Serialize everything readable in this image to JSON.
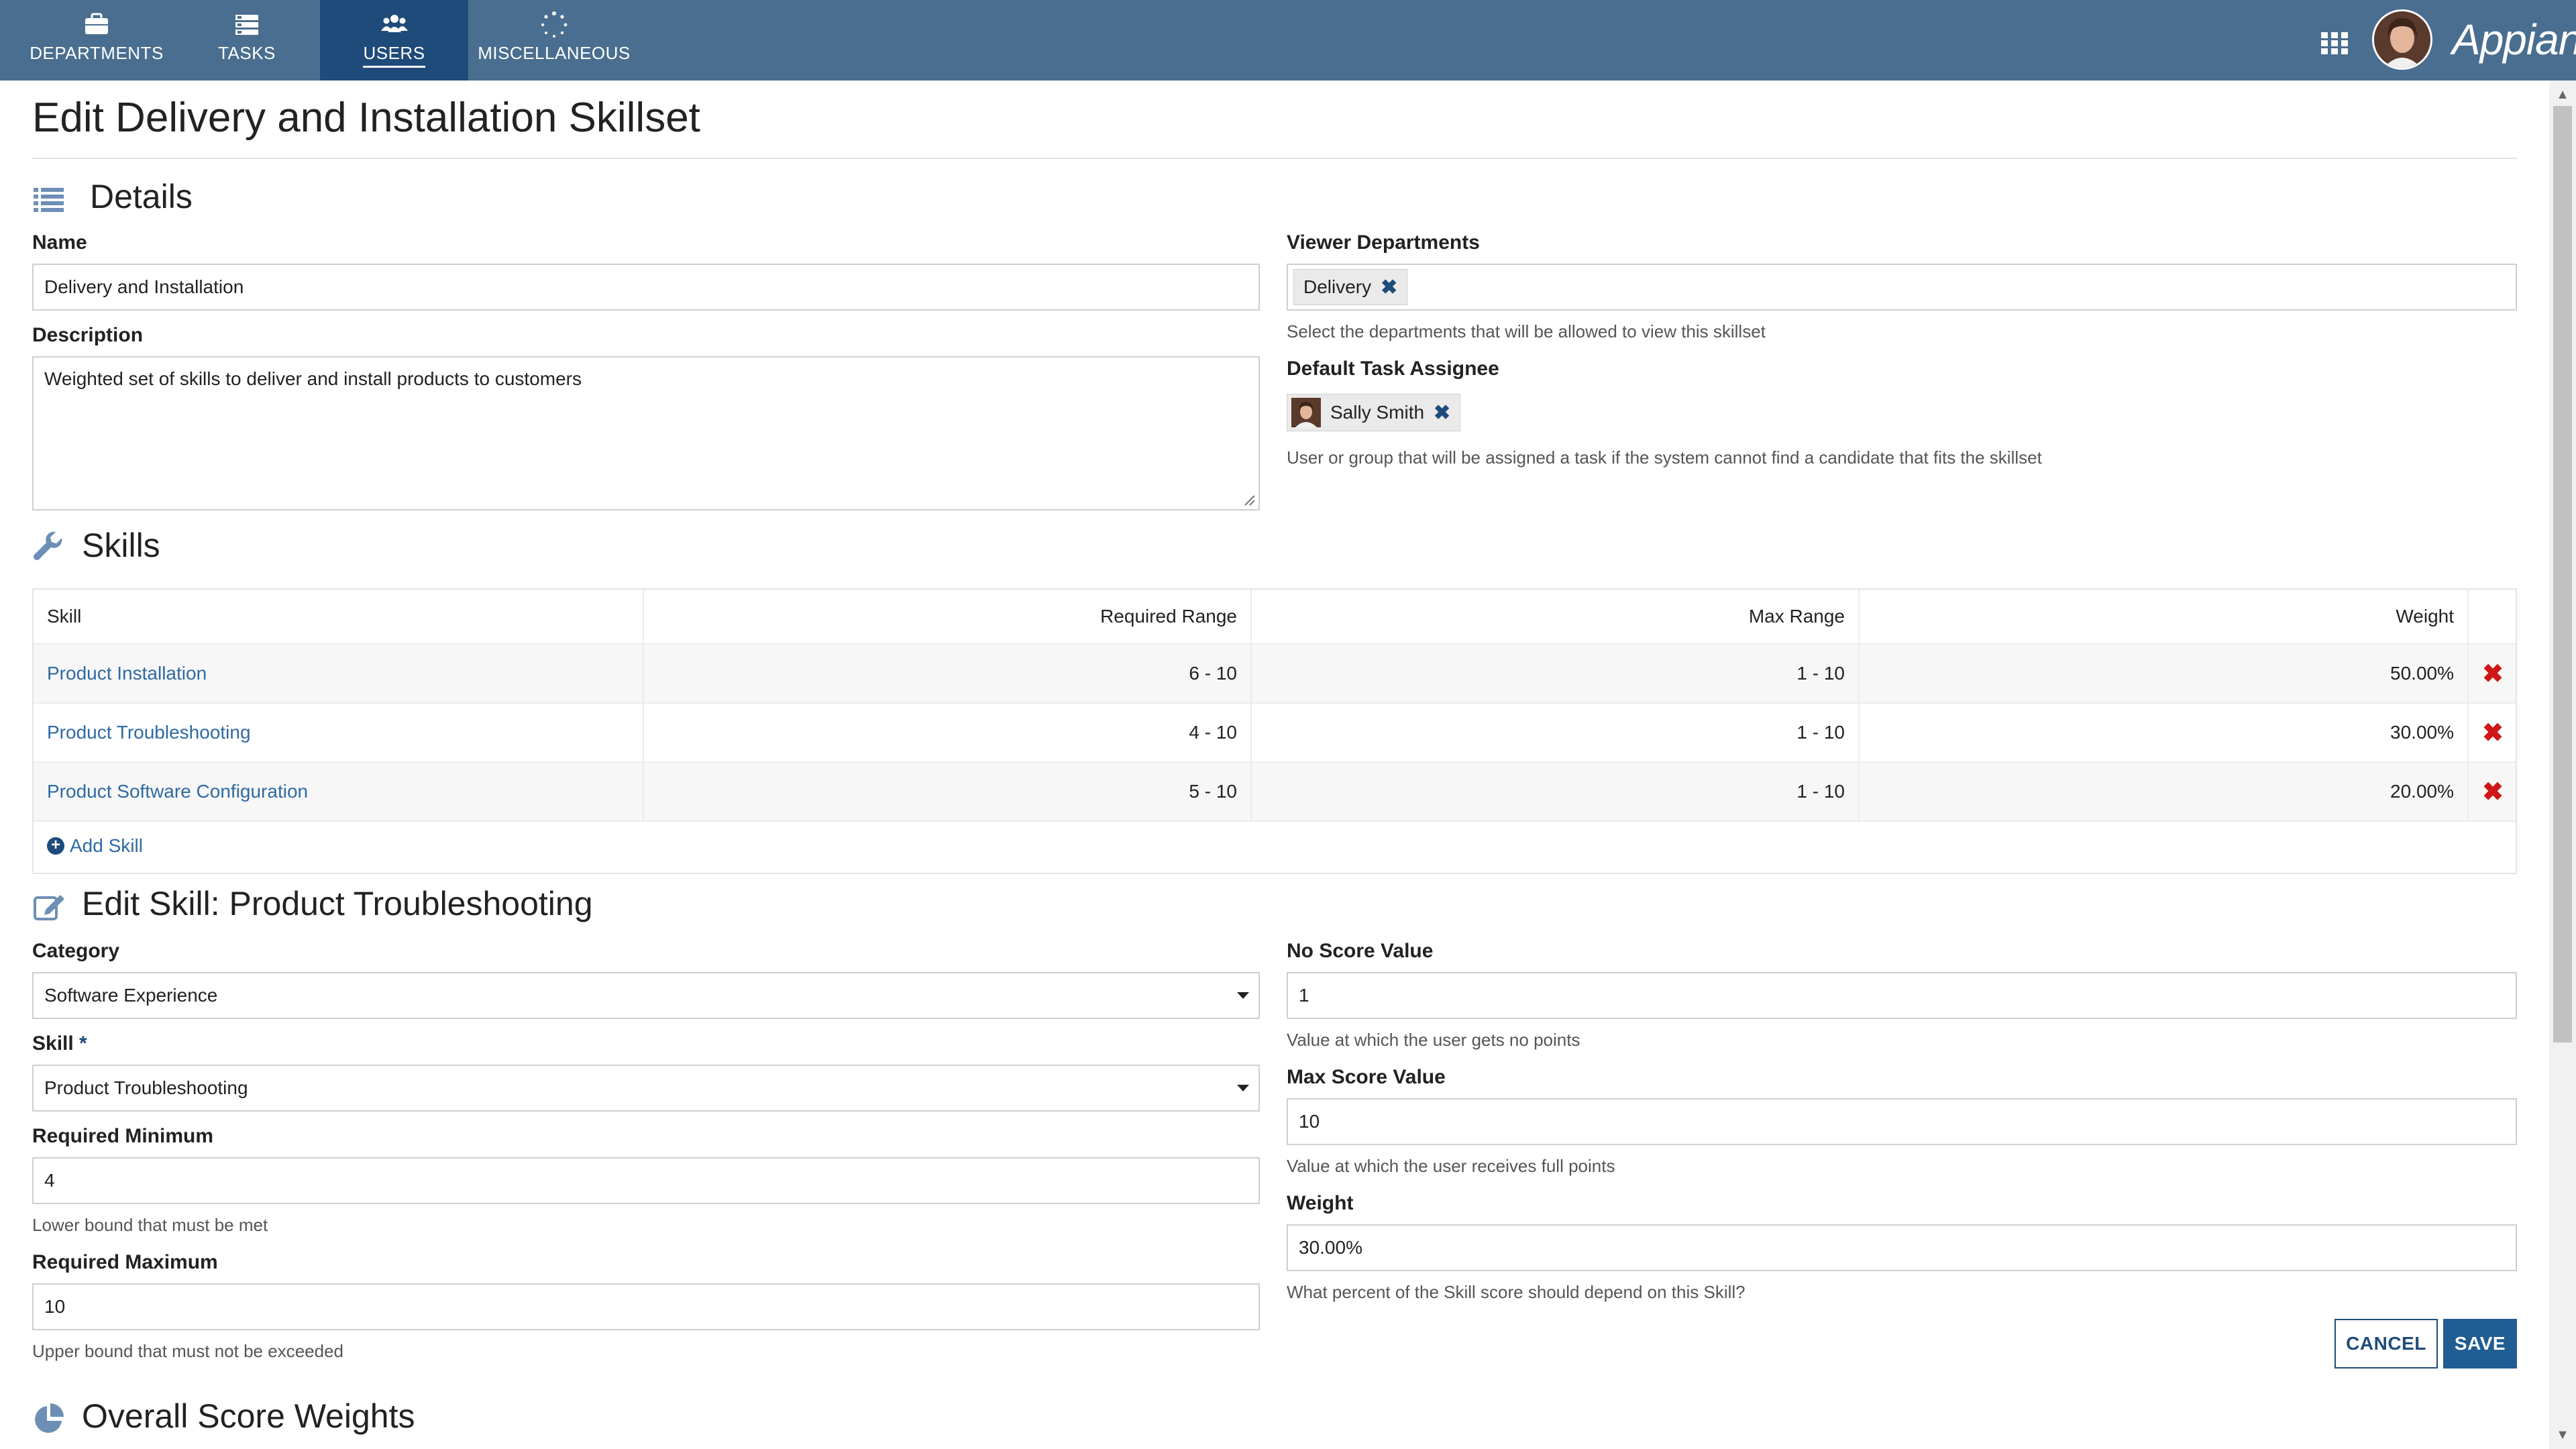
{
  "nav": {
    "tabs": [
      {
        "label": "DEPARTMENTS",
        "icon": "briefcase-icon"
      },
      {
        "label": "TASKS",
        "icon": "tasks-icon"
      },
      {
        "label": "USERS",
        "icon": "users-icon",
        "active": true
      },
      {
        "label": "MISCELLANEOUS",
        "icon": "loading-dots-icon"
      }
    ],
    "logo": "Appian",
    "colors": {
      "bar": "#4a6e8f",
      "active_tab": "#1f4b7a"
    }
  },
  "page": {
    "title": "Edit Delivery and Installation Skillset"
  },
  "details": {
    "heading": "Details",
    "name_label": "Name",
    "name_value": "Delivery and Installation",
    "description_label": "Description",
    "description_value": "Weighted set of skills to deliver and install products to customers",
    "viewer_label": "Viewer Departments",
    "viewer_chip": "Delivery",
    "viewer_hint": "Select the departments that will be allowed to view this skillset",
    "assignee_label": "Default Task Assignee",
    "assignee_chip": "Sally Smith",
    "assignee_hint": "User or group that will be assigned a task if the system cannot find a candidate that fits the skillset"
  },
  "skills": {
    "heading": "Skills",
    "columns": [
      "Skill",
      "Required Range",
      "Max Range",
      "Weight"
    ],
    "rows": [
      {
        "skill": "Product Installation",
        "required": "6 - 10",
        "max": "1 - 10",
        "weight": "50.00%"
      },
      {
        "skill": "Product Troubleshooting",
        "required": "4 - 10",
        "max": "1 - 10",
        "weight": "30.00%"
      },
      {
        "skill": "Product Software Configuration",
        "required": "5 - 10",
        "max": "1 - 10",
        "weight": "20.00%"
      }
    ],
    "add_label": "Add Skill"
  },
  "edit_skill": {
    "heading": "Edit Skill: Product Troubleshooting",
    "category_label": "Category",
    "category_value": "Software Experience",
    "skill_label": "Skill",
    "skill_required_marker": "*",
    "skill_value": "Product Troubleshooting",
    "req_min_label": "Required Minimum",
    "req_min_value": "4",
    "req_min_hint": "Lower bound that must be met",
    "req_max_label": "Required Maximum",
    "req_max_value": "10",
    "req_max_hint": "Upper bound that must not be exceeded",
    "no_score_label": "No Score Value",
    "no_score_value": "1",
    "no_score_hint": "Value at which the user gets no points",
    "max_score_label": "Max Score Value",
    "max_score_value": "10",
    "max_score_hint": "Value at which the user receives full points",
    "weight_label": "Weight",
    "weight_value": "30.00%",
    "weight_hint": "What percent of the Skill score should depend on this Skill?",
    "cancel_label": "CANCEL",
    "save_label": "SAVE"
  },
  "overall": {
    "heading": "Overall Score Weights"
  }
}
